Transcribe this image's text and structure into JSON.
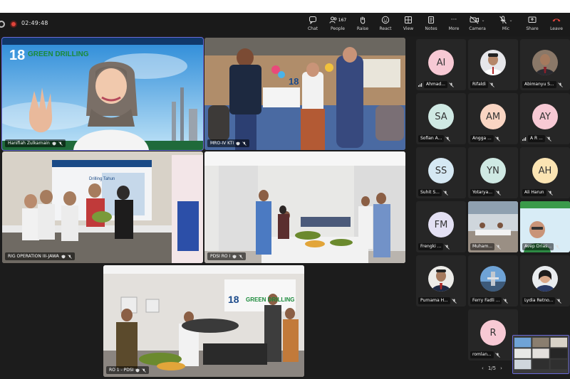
{
  "meeting": {
    "timer": "02:49:48"
  },
  "toolbar": {
    "buttons": [
      {
        "label": "Chat"
      },
      {
        "label": "People",
        "count": "167"
      },
      {
        "label": "Raise"
      },
      {
        "label": "React"
      },
      {
        "label": "View"
      },
      {
        "label": "Notes"
      },
      {
        "label": "More"
      }
    ],
    "devices": [
      {
        "label": "Camera"
      },
      {
        "label": "Mic"
      },
      {
        "label": "Share"
      },
      {
        "label": "Leave"
      }
    ],
    "more_glyph": "···"
  },
  "tiles": [
    {
      "name": "Hanifiah Zulkarnain",
      "backdrop_text": "GREEN DRILLING",
      "number": "18"
    },
    {
      "name": "MRO-IV KTI",
      "number": "18"
    },
    {
      "name": "RIG OPERATION III-JAWA",
      "banner": "Drilling Tahun"
    },
    {
      "name": "PDSI RO I"
    },
    {
      "name": "RO 1 - PDSI",
      "backdrop_text": "GREEN DRILLING",
      "number": "18"
    }
  ],
  "colors": {
    "accent": "#6a6ad8",
    "leave": "#e0443b",
    "recording": "#e0443b"
  },
  "participants": [
    {
      "name": "Ahmad...",
      "initials": "AI",
      "avatar_color": "#f7c9d4",
      "type": "initials"
    },
    {
      "name": "Rifaldi",
      "type": "photo"
    },
    {
      "name": "Abimanyu S...",
      "type": "photo"
    },
    {
      "name": "Sofian A...",
      "initials": "SA",
      "avatar_color": "#cfe9e3",
      "type": "initials"
    },
    {
      "name": "Angga ...",
      "initials": "AM",
      "avatar_color": "#f9d5c3",
      "type": "initials"
    },
    {
      "name": "A R ...",
      "initials": "AY",
      "avatar_color": "#f7c9d4",
      "type": "initials"
    },
    {
      "name": "Suhit S...",
      "initials": "SS",
      "avatar_color": "#d5e8f3",
      "type": "initials"
    },
    {
      "name": "Yotarya...",
      "initials": "YN",
      "avatar_color": "#cfe9e3",
      "type": "initials"
    },
    {
      "name": "Ali Harun",
      "initials": "AH",
      "avatar_color": "#fbe4b3",
      "type": "initials"
    },
    {
      "name": "Frengki ...",
      "initials": "FM",
      "avatar_color": "#e3e0f3",
      "type": "initials"
    },
    {
      "name": "Muham...",
      "type": "video"
    },
    {
      "name": "Avep Drias...",
      "type": "video"
    },
    {
      "name": "Purnama H...",
      "type": "photo"
    },
    {
      "name": "Ferry Fadli ...",
      "type": "photo"
    },
    {
      "name": "Lydia Retno...",
      "type": "photo"
    },
    {
      "name": "romlan...",
      "initials": "R",
      "avatar_color": "#f7c9d4",
      "type": "initials"
    }
  ],
  "pagination": {
    "label": "1/5",
    "prev": "‹",
    "next": "›"
  }
}
